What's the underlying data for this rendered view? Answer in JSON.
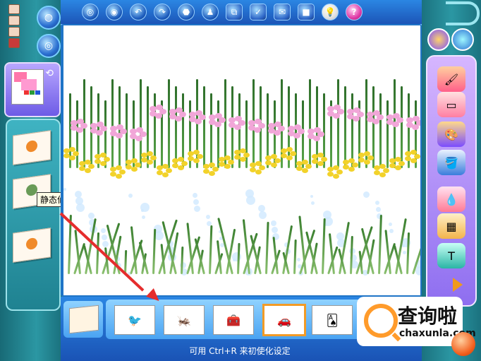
{
  "tooltip": {
    "text": "静态仙女袋"
  },
  "status_bar": {
    "text": "可用 Ctrl+R 来初使化设定"
  },
  "toolbar": {
    "buttons": [
      {
        "name": "globe-icon",
        "glyph": "◎"
      },
      {
        "name": "globe2-icon",
        "glyph": "◉"
      },
      {
        "name": "undo-icon",
        "glyph": "↶"
      },
      {
        "name": "redo-icon",
        "glyph": "↷"
      },
      {
        "name": "shape-icon",
        "glyph": "⬣"
      },
      {
        "name": "person-icon",
        "glyph": "♟"
      },
      {
        "name": "copy-icon",
        "glyph": "⧉"
      },
      {
        "name": "check-icon",
        "glyph": "✓"
      },
      {
        "name": "mail-icon",
        "glyph": "✉"
      },
      {
        "name": "stop-icon",
        "glyph": "■"
      },
      {
        "name": "bulb-icon",
        "glyph": "💡"
      },
      {
        "name": "help-icon",
        "glyph": "?"
      }
    ]
  },
  "thumbnails": [
    {
      "name": "bird-thumb",
      "glyph": "🐦"
    },
    {
      "name": "grasshopper-thumb",
      "glyph": "🦗"
    },
    {
      "name": "tools-thumb",
      "glyph": "🧰"
    },
    {
      "name": "car-thumb",
      "glyph": "🚗",
      "selected": true
    },
    {
      "name": "cards-thumb",
      "glyph": "🂡"
    }
  ],
  "watermark": {
    "brand": "查询啦",
    "url": "chaxunla.com"
  },
  "colors": {
    "frame_blue": "#1f74c7",
    "rail_teal": "#2b97a3",
    "accent_orange": "#f29b26",
    "tool_panel": "#8e6ef0",
    "annotation_red": "#e52d2d"
  }
}
